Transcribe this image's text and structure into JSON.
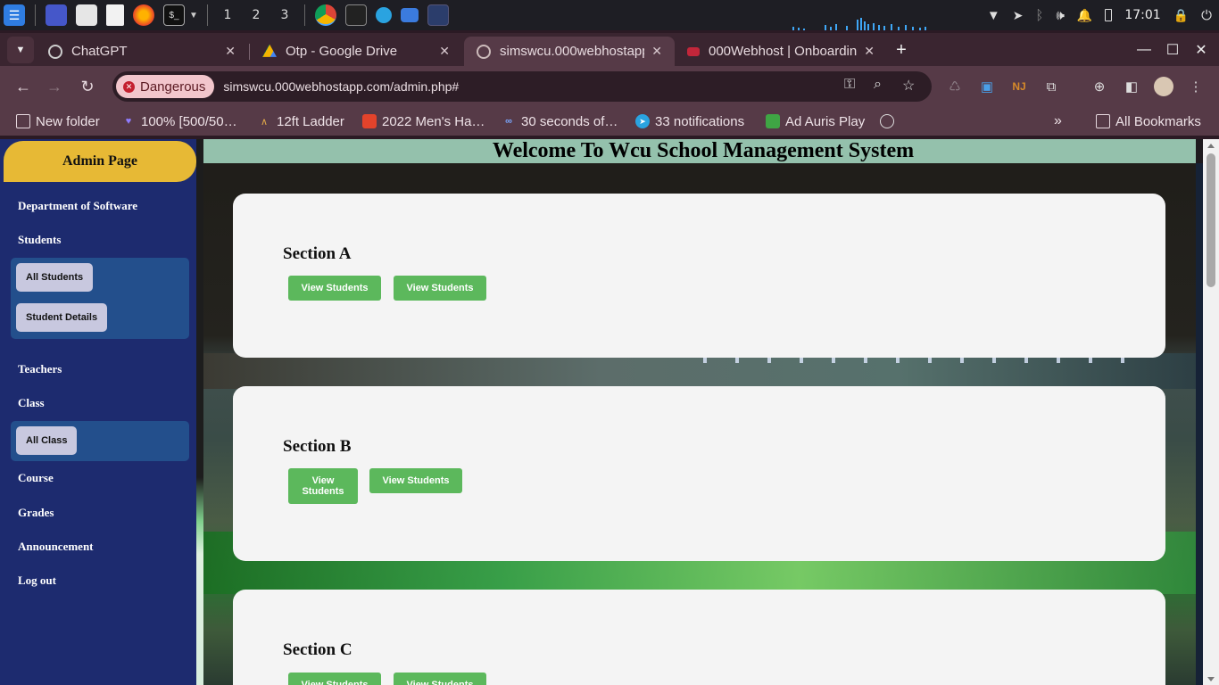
{
  "taskbar": {
    "workspaces": [
      "1",
      "2",
      "3"
    ],
    "clock": "17:01"
  },
  "browser": {
    "tabs": [
      {
        "title": "ChatGPT",
        "icon": "chatgpt-icon"
      },
      {
        "title": "Otp - Google Drive",
        "icon": "google-drive-icon"
      },
      {
        "title": "simswcu.000webhostapp",
        "icon": "globe-icon"
      },
      {
        "title": "000Webhost | Onboardin",
        "icon": "000webhost-icon"
      }
    ],
    "security_label": "Dangerous",
    "url": "simswcu.000webhostapp.com/admin.php#",
    "bookmarks": [
      {
        "label": "New folder",
        "icon": "folder-icon"
      },
      {
        "label": "100% [500/50…",
        "icon": "heart-icon"
      },
      {
        "label": "12ft Ladder",
        "icon": "ladder-icon"
      },
      {
        "label": "2022 Men's Ha…",
        "icon": "shopping-icon"
      },
      {
        "label": "30 seconds of…",
        "icon": "code-icon"
      },
      {
        "label": "33 notifications",
        "icon": "telegram-icon"
      },
      {
        "label": "Ad Auris Play",
        "icon": "audio-icon"
      }
    ],
    "all_bookmarks": "All Bookmarks"
  },
  "sidebar": {
    "title": "Admin Page",
    "items": {
      "department": "Department of Software",
      "students": "Students",
      "teachers": "Teachers",
      "class": "Class",
      "course": "Course",
      "grades": "Grades",
      "announcement": "Announcement",
      "logout": "Log out"
    },
    "students_sub": [
      "All Students",
      "Student Details"
    ],
    "class_sub": [
      "All Class"
    ]
  },
  "main": {
    "title": "Welcome To Wcu School Management System",
    "sections": [
      {
        "name": "Section A",
        "buttons": [
          "View Students",
          "View Students"
        ]
      },
      {
        "name": "Section B",
        "buttons": [
          "View Students",
          "View Students"
        ]
      },
      {
        "name": "Section C",
        "buttons": [
          "View Students",
          "View Students"
        ]
      }
    ]
  },
  "colors": {
    "sidebar_bg": "#1d2b6f",
    "sidebar_header": "#e7b935",
    "submenu_bg": "#234f8c",
    "title_bar": "#94c1ac",
    "action_button": "#5cb85c",
    "danger_chip": "#f2c6cc"
  }
}
